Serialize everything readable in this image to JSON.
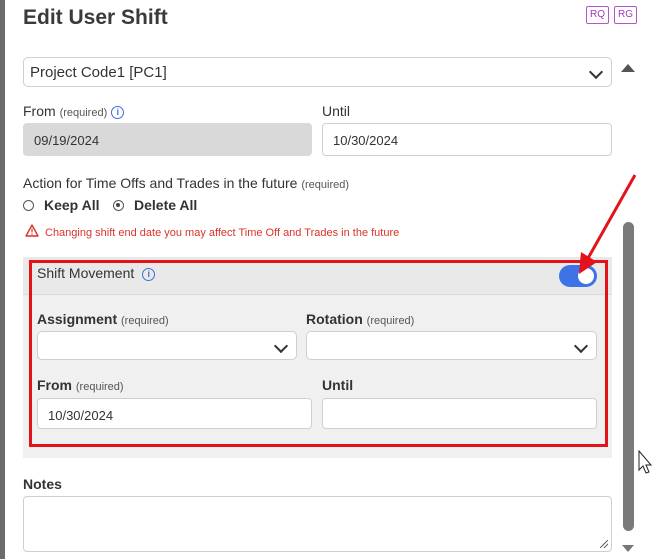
{
  "dialog": {
    "title": "Edit User Shift",
    "badges": [
      "RQ",
      "RG"
    ]
  },
  "project": {
    "value": "Project Code1 [PC1]"
  },
  "dates": {
    "from_label": "From",
    "from_req": "(required)",
    "from_value": "09/19/2024",
    "until_label": "Until",
    "until_value": "10/30/2024"
  },
  "action": {
    "label": "Action for Time Offs and Trades in the future",
    "req": "(required)",
    "options": [
      "Keep All",
      "Delete All"
    ],
    "selected": "Delete All",
    "warning": "Changing shift end date you may affect Time Off and Trades in the future"
  },
  "movement": {
    "title": "Shift Movement",
    "enabled": true,
    "assignment_label": "Assignment",
    "assignment_req": "(required)",
    "assignment_value": "",
    "rotation_label": "Rotation",
    "rotation_req": "(required)",
    "rotation_value": "",
    "from_label": "From",
    "from_req": "(required)",
    "from_value": "10/30/2024",
    "until_label": "Until",
    "until_value": ""
  },
  "notes": {
    "label": "Notes",
    "value": ""
  },
  "colors": {
    "accent": "#3d73e6",
    "highlight": "#e3131b",
    "warning": "#d9342b",
    "badge": "#a23bb8"
  }
}
